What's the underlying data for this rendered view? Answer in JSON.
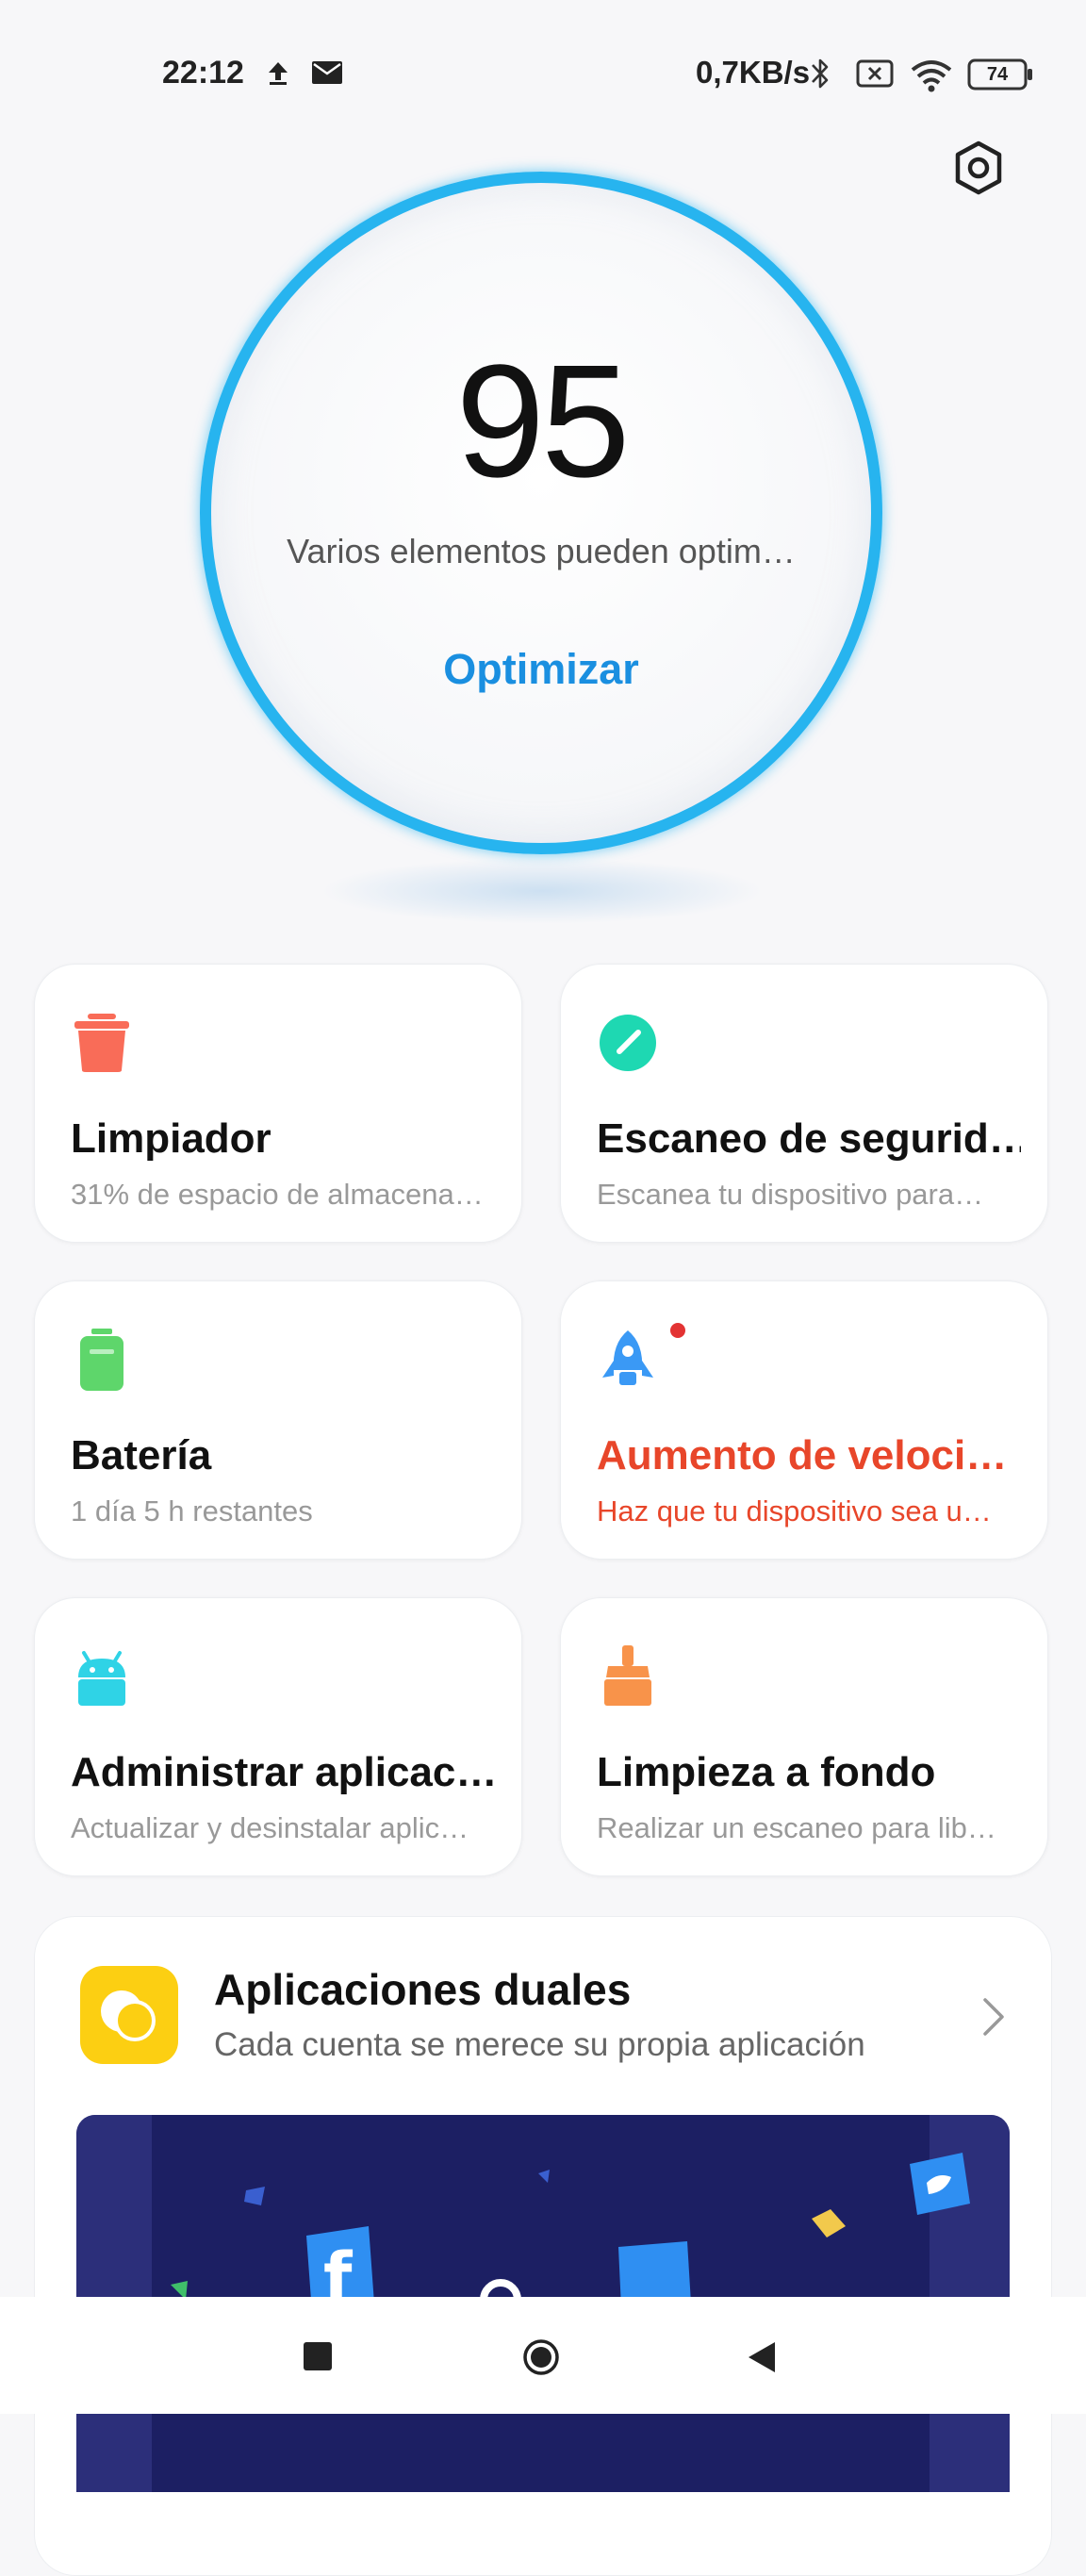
{
  "status_bar": {
    "time": "22:12",
    "speed": "0,7KB/s",
    "battery_level": "74",
    "icons": [
      "upload-icon",
      "mail-icon",
      "bluetooth-icon",
      "no-sim-icon",
      "wifi-icon",
      "battery-icon"
    ]
  },
  "score": {
    "value": "95",
    "subtitle": "Varios elementos pueden optim…",
    "action_label": "Optimizar",
    "ring_color": "#27b4ef"
  },
  "features": [
    {
      "title": "Limpiador",
      "desc": "31% de espacio de almacena…",
      "icon": "trash-icon",
      "color": "#f96c58"
    },
    {
      "title": "Escaneo de segurid…",
      "desc": "Escanea tu dispositivo para…",
      "icon": "shield-check-icon",
      "color": "#1ed8b2"
    },
    {
      "title": "Batería",
      "desc": "1 día 5 h  restantes",
      "icon": "battery-icon",
      "color": "#5ed66b"
    },
    {
      "title": "Aumento de veloci…",
      "desc": "Haz que tu dispositivo sea u…",
      "icon": "rocket-icon",
      "color": "#3a99f5",
      "alert_color": "#e8462a"
    },
    {
      "title": "Administrar aplicac…",
      "desc": "Actualizar y desinstalar aplic…",
      "icon": "android-icon",
      "color": "#2fd3e6"
    },
    {
      "title": "Limpieza a fondo",
      "desc": "Realizar un escaneo para lib…",
      "icon": "brush-icon",
      "color": "#f8934a"
    }
  ],
  "dual_apps": {
    "title": "Aplicaciones duales",
    "desc": "Cada cuenta se merece su propia aplicación",
    "icon_color": "#fccf12",
    "banner_color": "#1c1f63"
  },
  "nav": {
    "recent": "recent-apps-icon",
    "home": "home-icon",
    "back": "back-icon"
  }
}
